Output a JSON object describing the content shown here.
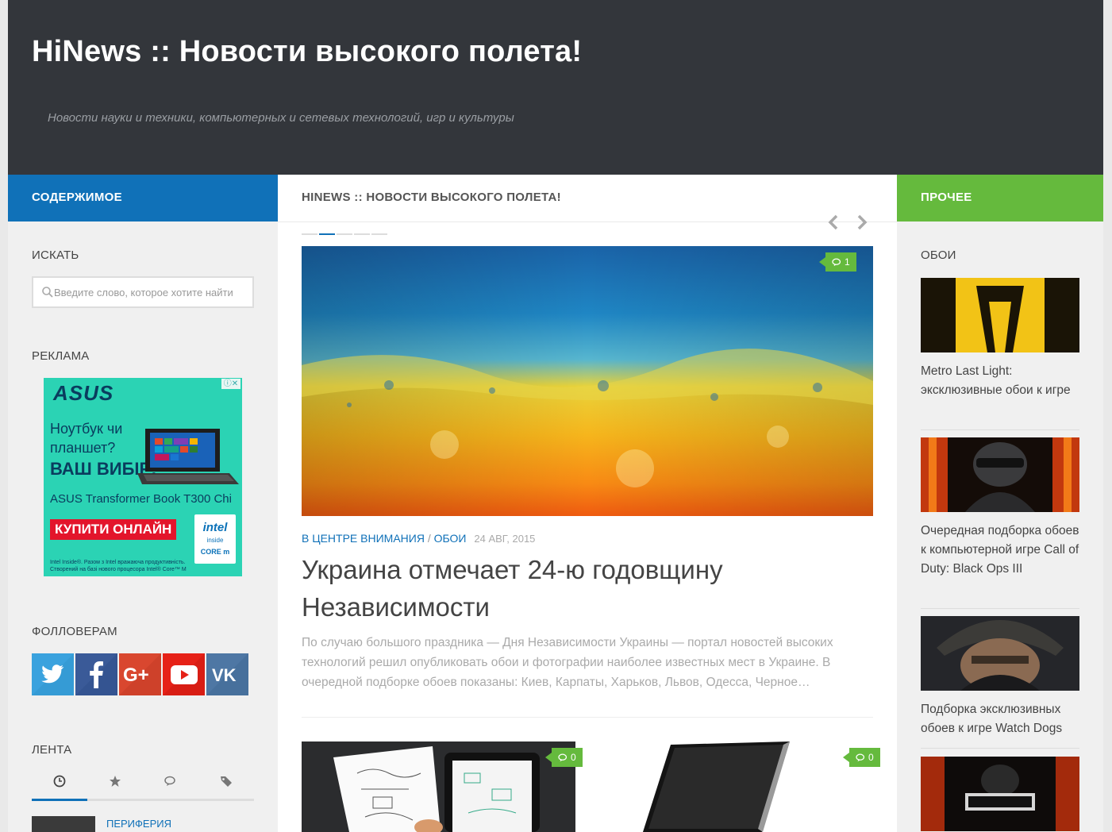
{
  "header": {
    "site_title": "HiNews :: Новости высокого полета!",
    "tagline": "Новости науки и техники, компьютерных и сетевых технологий, игр и культуры"
  },
  "left": {
    "heading": "СОДЕРЖИМОЕ",
    "search": {
      "title": "ИСКАТЬ",
      "placeholder": "Введите слово, которое хотите найти"
    },
    "ad": {
      "title": "РЕКЛАМА",
      "brand": "ASUS",
      "question": "Ноутбук чи планшет?",
      "choice": "ВАШ ВИБІР!",
      "model": "ASUS Transformer Book T300 Chi",
      "cta": "КУПИТИ ОНЛАЙН",
      "fine_print": "Intel Inside®. Разом з Intel вражаюча продуктивність. Створений на базі нового процесора Intel® Core™ M",
      "intel_line1": "intel",
      "intel_line2": "inside",
      "intel_line3": "CORE m"
    },
    "followers": {
      "title": "ФОЛЛОВЕРАМ",
      "networks": [
        {
          "name": "twitter",
          "color": "#3aa2de"
        },
        {
          "name": "facebook",
          "color": "#3a5a98"
        },
        {
          "name": "google-plus",
          "color": "#d9472f"
        },
        {
          "name": "youtube",
          "color": "#e62117"
        },
        {
          "name": "vk",
          "color": "#4e77a4"
        }
      ]
    },
    "feed": {
      "title": "ЛЕНТА",
      "tabs": [
        "recent-icon",
        "popular-icon",
        "comments-icon",
        "tags-icon"
      ],
      "active_tab": 0,
      "first_item_category": "ПЕРИФЕРИЯ"
    }
  },
  "main": {
    "heading": "HINEWS :: НОВОСТИ ВЫСОКОГО ПОЛЕТА!",
    "slider": {
      "dots": 5,
      "active_dot": 1
    },
    "featured": {
      "comments": "1",
      "categories": [
        "В ЦЕНТРЕ ВНИМАНИЯ",
        "ОБОИ"
      ],
      "category_sep": "/",
      "date": "24 АВГ, 2015",
      "title": "Украина отмечает 24-ю годовщину Независимости",
      "excerpt": "По случаю большого праздника — Дня Независимости Украины — портал новостей высоких технологий решил опубликовать обои и фотографии наиболее известных мест в Украине. В очередной подборке обоев показаны: Киев, Карпаты, Харьков, Львов, Одесса, Черное…"
    },
    "grid": [
      {
        "comments": "0"
      },
      {
        "comments": "0"
      }
    ]
  },
  "right": {
    "heading": "ПРОЧЕЕ",
    "wallpapers": {
      "title": "ОБОИ",
      "items": [
        {
          "title": "Metro Last Light: эксклюзивные обои к игре"
        },
        {
          "title": "Очередная подборка обоев к компьютерной игре Call of Duty: Black Ops III"
        },
        {
          "title": "Подборка эксклюзивных обоев к игре Watch Dogs"
        },
        {
          "title": ""
        }
      ]
    }
  },
  "colors": {
    "header_bg": "#33363b",
    "left_accent": "#1071b8",
    "right_accent": "#65ba3d",
    "link": "#1071b8"
  }
}
